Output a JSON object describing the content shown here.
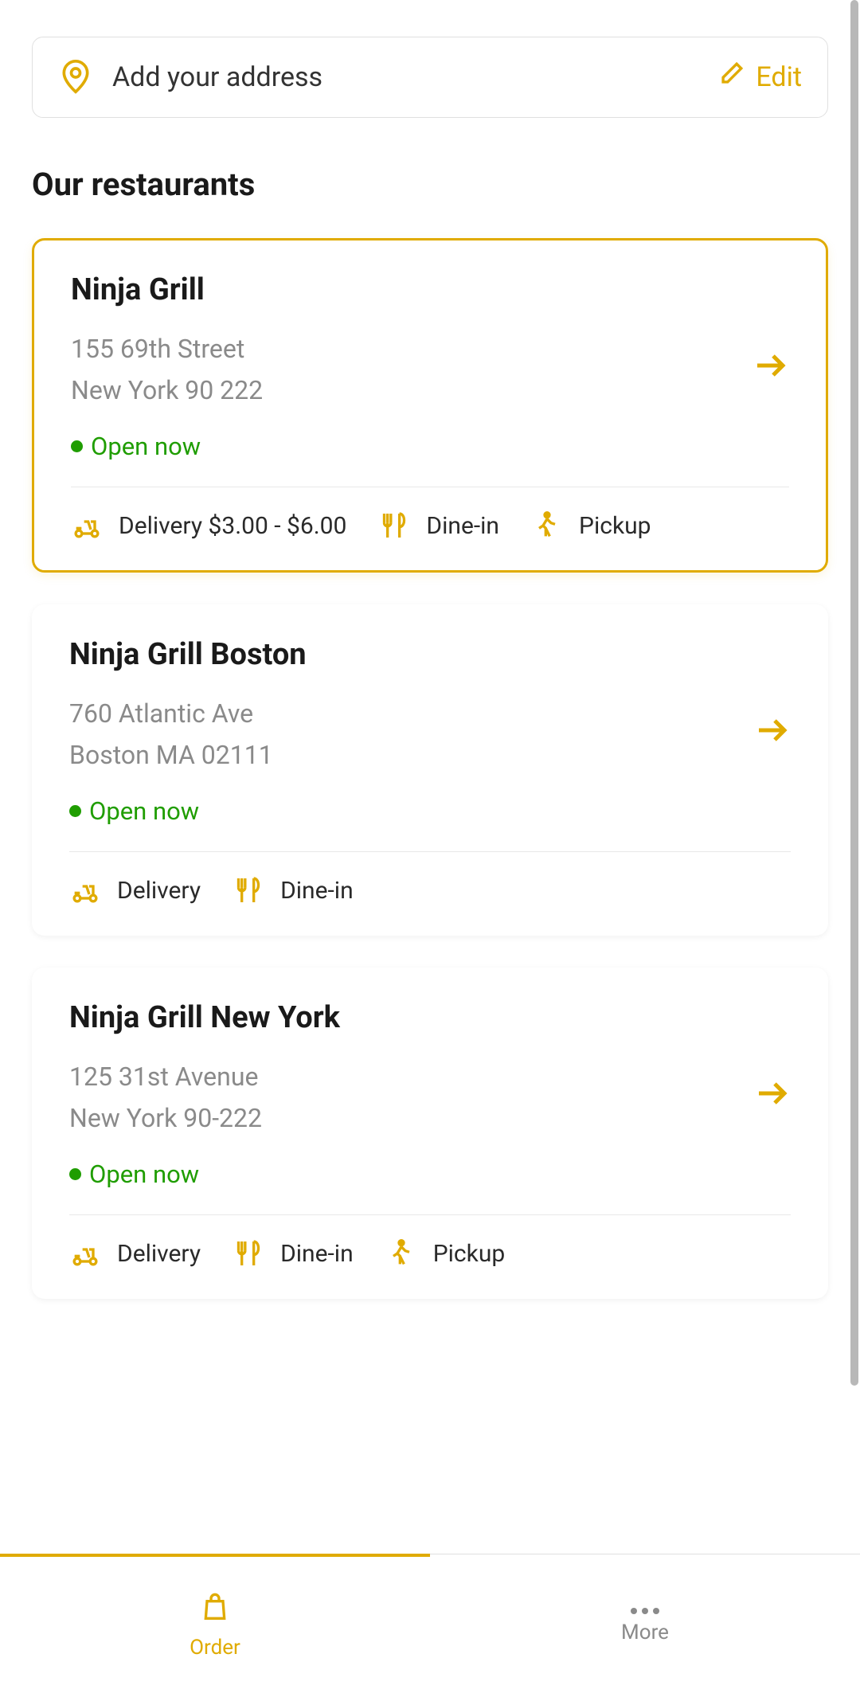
{
  "address_bar": {
    "placeholder": "Add your address",
    "edit_label": "Edit"
  },
  "section_title": "Our restaurants",
  "restaurants": [
    {
      "name": "Ninja Grill",
      "address_line1": "155 69th Street",
      "address_line2": "New York 90 222",
      "status": "Open now",
      "selected": true,
      "services": [
        {
          "icon": "moped",
          "label": "Delivery $3.00 - $6.00"
        },
        {
          "icon": "utensils",
          "label": "Dine-in"
        },
        {
          "icon": "walk",
          "label": "Pickup"
        }
      ]
    },
    {
      "name": "Ninja Grill Boston",
      "address_line1": "760 Atlantic Ave",
      "address_line2": "Boston MA 02111",
      "status": "Open now",
      "selected": false,
      "services": [
        {
          "icon": "moped",
          "label": "Delivery"
        },
        {
          "icon": "utensils",
          "label": "Dine-in"
        }
      ]
    },
    {
      "name": "Ninja Grill New York",
      "address_line1": "125 31st Avenue",
      "address_line2": "New York 90-222",
      "status": "Open now",
      "selected": false,
      "services": [
        {
          "icon": "moped",
          "label": "Delivery"
        },
        {
          "icon": "utensils",
          "label": "Dine-in"
        },
        {
          "icon": "walk",
          "label": "Pickup"
        }
      ]
    }
  ],
  "nav": {
    "order": "Order",
    "more": "More"
  }
}
